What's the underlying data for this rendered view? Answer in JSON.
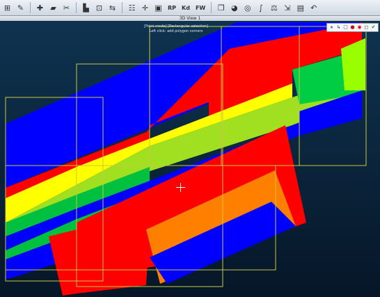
{
  "toolbar": {
    "items": [
      {
        "name": "point-size-icon",
        "glyph": "⊞"
      },
      {
        "name": "edit-icon",
        "glyph": "✎"
      },
      {
        "name": "add-point-icon",
        "glyph": "✚"
      },
      {
        "name": "clip-icon",
        "glyph": "▰"
      },
      {
        "name": "segment-icon",
        "glyph": "✂"
      },
      {
        "name": "histogram-icon",
        "glyph": "▙"
      },
      {
        "name": "align-icon",
        "glyph": "⊡"
      },
      {
        "name": "register-icon",
        "glyph": "⇆"
      },
      {
        "name": "level-icon",
        "glyph": "☷"
      },
      {
        "name": "center-icon",
        "glyph": "✛"
      },
      {
        "name": "match-icon",
        "glyph": "▣"
      }
    ],
    "wide_items": [
      {
        "name": "rp-button",
        "label": "RP"
      },
      {
        "name": "kd-button",
        "label": "Kd"
      },
      {
        "name": "fw-button",
        "label": "FW"
      }
    ],
    "tail_items": [
      {
        "name": "document-icon",
        "glyph": "❐"
      },
      {
        "name": "color-wheel-icon",
        "glyph": "◕"
      },
      {
        "name": "sphere-icon",
        "glyph": "◎"
      },
      {
        "name": "curve-icon",
        "glyph": "∫"
      },
      {
        "name": "scale-icon",
        "glyph": "⚖"
      },
      {
        "name": "export-icon",
        "glyph": "⇲"
      },
      {
        "name": "screen-icon",
        "glyph": "▤"
      },
      {
        "name": "back-icon",
        "glyph": "↶"
      }
    ]
  },
  "view": {
    "title": "3D View 1",
    "hint_line1": "[Point mode] [Rectangular selection]",
    "hint_line2": "Left click: add polygon corners"
  },
  "mini_tools": [
    {
      "name": "pause-icon",
      "glyph": "⏸"
    },
    {
      "name": "polyline-icon",
      "glyph": "↳"
    },
    {
      "name": "rect-select-icon",
      "glyph": "▢"
    },
    {
      "name": "stop-icon",
      "glyph": "●"
    },
    {
      "name": "segment-in-icon",
      "glyph": "◉"
    },
    {
      "name": "segment-out-icon",
      "glyph": "◻"
    },
    {
      "name": "validate-icon",
      "glyph": "✔"
    }
  ],
  "colors": {
    "blue": "#0000ff",
    "red": "#ff0000",
    "yellow": "#ffff00",
    "green": "#00c040",
    "orange": "#ff8000",
    "lime": "#99ff00",
    "frame": "#c8c840"
  }
}
